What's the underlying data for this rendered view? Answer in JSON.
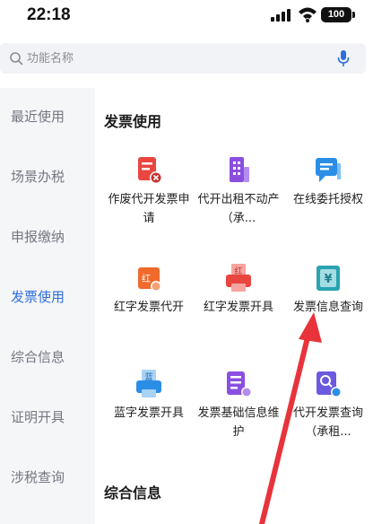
{
  "status_bar": {
    "time": "22:18",
    "battery": "100"
  },
  "search": {
    "placeholder": "功能名称"
  },
  "sidebar": {
    "items": [
      {
        "label": "最近使用",
        "active": false
      },
      {
        "label": "场景办税",
        "active": false
      },
      {
        "label": "申报缴纳",
        "active": false
      },
      {
        "label": "发票使用",
        "active": true
      },
      {
        "label": "综合信息",
        "active": false
      },
      {
        "label": "证明开具",
        "active": false
      },
      {
        "label": "涉税查询",
        "active": false
      }
    ]
  },
  "main": {
    "section_title": "发票使用",
    "next_section_title": "综合信息",
    "tiles": [
      {
        "label": "作废代开发票申请",
        "icon": "invoice-void-icon",
        "color": "#e8463f"
      },
      {
        "label": "代开出租不动产（承...",
        "icon": "building-icon",
        "color": "#8a4fe0"
      },
      {
        "label": "在线委托授权",
        "icon": "chat-authorize-icon",
        "color": "#2b8ee6"
      },
      {
        "label": "红字发票代开",
        "icon": "red-invoice-proxy-icon",
        "color": "#f06a2c",
        "glyph": "红"
      },
      {
        "label": "红字发票开具",
        "icon": "red-invoice-printer-icon",
        "color": "#e8463f",
        "glyph": "红"
      },
      {
        "label": "发票信息查询",
        "icon": "invoice-query-icon",
        "color": "#2aa3b0",
        "glyph": "¥"
      },
      {
        "label": "蓝字发票开具",
        "icon": "blue-invoice-printer-icon",
        "color": "#2b8ee6",
        "glyph": "蓝"
      },
      {
        "label": "发票基础信息维护",
        "icon": "invoice-maintenance-icon",
        "color": "#8a4fe0"
      },
      {
        "label": "代开发票查询（承租...",
        "icon": "proxy-invoice-query-icon",
        "color": "#6a5ae0"
      }
    ]
  },
  "colors": {
    "accent": "#2f6fdb",
    "annotation_arrow": "#e8333a"
  }
}
